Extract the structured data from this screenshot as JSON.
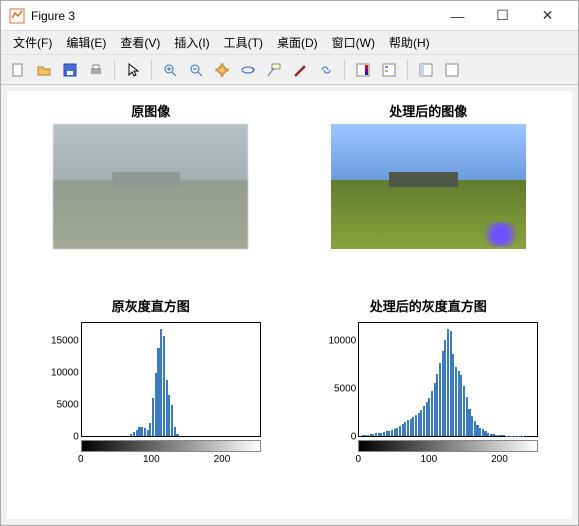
{
  "window": {
    "title": "Figure 3",
    "min": "—",
    "max": "☐",
    "close": "✕"
  },
  "menu": {
    "file": "文件(F)",
    "edit": "编辑(E)",
    "view": "查看(V)",
    "insert": "插入(I)",
    "tools": "工具(T)",
    "desktop": "桌面(D)",
    "window": "窗口(W)",
    "help": "帮助(H)"
  },
  "subplots": {
    "img_orig_title": "原图像",
    "img_proc_title": "处理后的图像",
    "hist_orig_title": "原灰度直方图",
    "hist_proc_title": "处理后的灰度直方图"
  },
  "chart_data": [
    {
      "type": "bar",
      "title": "原灰度直方图",
      "xlabel": "",
      "ylabel": "",
      "xlim": [
        0,
        255
      ],
      "ylim": [
        0,
        18000
      ],
      "xticks": [
        0,
        100,
        200
      ],
      "yticks": [
        0,
        5000,
        10000,
        15000
      ],
      "categories_range": [
        0,
        255
      ],
      "values_approx": [
        0,
        0,
        0,
        0,
        0,
        0,
        0,
        0,
        0,
        0,
        0,
        0,
        0,
        0,
        0,
        0,
        0,
        0,
        0,
        0,
        0,
        0,
        0,
        0,
        0,
        0,
        0,
        0,
        0,
        0,
        0,
        0,
        0,
        0,
        0,
        0,
        0,
        0,
        0,
        0,
        0,
        0,
        0,
        0,
        0,
        0,
        0,
        0,
        0,
        0,
        0,
        0,
        0,
        0,
        0,
        0,
        0,
        0,
        0,
        0,
        0,
        0,
        0,
        0,
        0,
        0,
        0,
        0,
        0,
        0,
        200,
        300,
        400,
        500,
        600,
        700,
        800,
        900,
        1000,
        1000,
        1200,
        1200,
        1300,
        1400,
        1500,
        1500,
        1400,
        1300,
        1200,
        1100,
        1000,
        900,
        800,
        800,
        800,
        900,
        1000,
        1200,
        1500,
        2000,
        3000,
        4000,
        5000,
        6000,
        7000,
        8000,
        9000,
        10000,
        11000,
        12000,
        13000,
        14000,
        15000,
        16000,
        17000,
        16500,
        16000,
        15000,
        13000,
        11000,
        9000,
        7500,
        7000,
        6800,
        6500,
        6200,
        6000,
        5500,
        5000,
        4000,
        3000,
        2000,
        1500,
        1000,
        700,
        500,
        300,
        200,
        100,
        50,
        0,
        0,
        0,
        0,
        0,
        0,
        0,
        0,
        0,
        0,
        0,
        0,
        0,
        0,
        0,
        0,
        0,
        0,
        0,
        0,
        0,
        0,
        0,
        0,
        0,
        0,
        0,
        0,
        0,
        0,
        0,
        0,
        0,
        0,
        0,
        0,
        0,
        0,
        0,
        0,
        0,
        0,
        0,
        0,
        0,
        0,
        0,
        0,
        0,
        0,
        0,
        0,
        0,
        0,
        0,
        0,
        0,
        0,
        0,
        0,
        0,
        0,
        0,
        0,
        0,
        0,
        0,
        0,
        0,
        0,
        0,
        0,
        0,
        0,
        0,
        0,
        0,
        0,
        0,
        0,
        0,
        0,
        0,
        0,
        0,
        0,
        0,
        0,
        0,
        0,
        0,
        0,
        0,
        0,
        0,
        0,
        0,
        0,
        0,
        0,
        0,
        0,
        0,
        0,
        0,
        0,
        0,
        0,
        0,
        0,
        0,
        0,
        0,
        0,
        0,
        0
      ]
    },
    {
      "type": "bar",
      "title": "处理后的灰度直方图",
      "xlabel": "",
      "ylabel": "",
      "xlim": [
        0,
        255
      ],
      "ylim": [
        0,
        12000
      ],
      "xticks": [
        0,
        100,
        200
      ],
      "yticks": [
        0,
        5000,
        10000
      ],
      "categories_range": [
        0,
        255
      ],
      "values_approx": [
        50,
        60,
        70,
        80,
        90,
        100,
        110,
        120,
        130,
        140,
        150,
        160,
        170,
        180,
        190,
        200,
        210,
        220,
        230,
        240,
        250,
        260,
        270,
        280,
        290,
        300,
        310,
        320,
        330,
        340,
        350,
        360,
        370,
        380,
        390,
        400,
        420,
        440,
        460,
        480,
        500,
        520,
        540,
        560,
        580,
        600,
        630,
        660,
        690,
        720,
        750,
        780,
        810,
        840,
        870,
        900,
        940,
        980,
        1020,
        1060,
        1100,
        1150,
        1200,
        1250,
        1300,
        1350,
        1400,
        1450,
        1500,
        1550,
        1600,
        1650,
        1700,
        1750,
        1800,
        1850,
        1900,
        1950,
        2000,
        2050,
        2100,
        2150,
        2200,
        2250,
        2300,
        2350,
        2400,
        2450,
        2500,
        2600,
        2700,
        2800,
        2900,
        3000,
        3100,
        3200,
        3300,
        3400,
        3500,
        3600,
        3700,
        3800,
        3900,
        4000,
        4200,
        4400,
        4600,
        4800,
        5000,
        5200,
        5400,
        5600,
        5800,
        6000,
        6300,
        6600,
        6900,
        7200,
        7500,
        7800,
        8100,
        8400,
        8700,
        9000,
        9300,
        9600,
        9900,
        10200,
        10500,
        10800,
        11100,
        11400,
        11100,
        10500,
        9900,
        9300,
        8700,
        8100,
        7700,
        7500,
        7300,
        7200,
        7100,
        7000,
        6900,
        6800,
        6700,
        6600,
        6500,
        6200,
        5900,
        5600,
        5300,
        5000,
        4700,
        4400,
        4100,
        3800,
        3500,
        3200,
        2900,
        2700,
        2500,
        2300,
        2100,
        1900,
        1800,
        1700,
        1600,
        1500,
        1400,
        1300,
        1200,
        1100,
        1000,
        950,
        900,
        850,
        800,
        750,
        700,
        650,
        600,
        560,
        520,
        480,
        440,
        400,
        370,
        340,
        310,
        280,
        260,
        240,
        220,
        200,
        180,
        160,
        150,
        140,
        130,
        120,
        110,
        100,
        95,
        90,
        85,
        80,
        75,
        70,
        65,
        60,
        58,
        56,
        54,
        52,
        50,
        48,
        46,
        44,
        42,
        40,
        38,
        36,
        34,
        32,
        30,
        28,
        26,
        24,
        22,
        20,
        19,
        18,
        17,
        16,
        15,
        14,
        13,
        12,
        11,
        10,
        9,
        8,
        7,
        6,
        5,
        4,
        3,
        2,
        1,
        0,
        0,
        0,
        0,
        0,
        0
      ]
    }
  ]
}
